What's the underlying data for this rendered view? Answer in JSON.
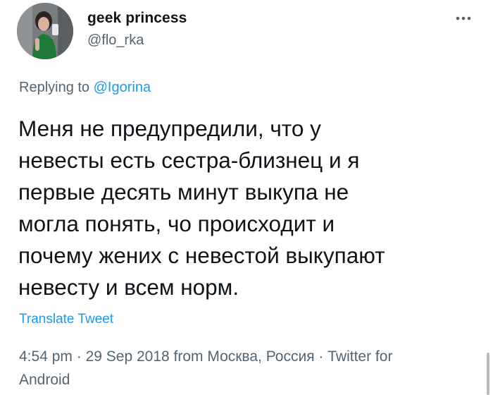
{
  "author": {
    "display_name": "geek princess",
    "handle": "@flo_rka"
  },
  "reply": {
    "prefix": "Replying to ",
    "mention": "@Igorina"
  },
  "tweet": {
    "lines": [
      "Меня не предупредили, что у",
      "невесты есть сестра-близнец и я",
      "первые десять минут выкупа не",
      "могла понять, чо происходит и",
      "почему жених с невестой выкупают",
      "невесту и всем норм."
    ]
  },
  "translate_label": "Translate Tweet",
  "meta": {
    "time": "4:54 pm",
    "sep1": " · ",
    "date": "29 Sep 2018",
    "location": " from Москва, Россия",
    "sep2": " · ",
    "source_line1": "Twitter for",
    "source_line2": "Android"
  },
  "icons": {
    "more": "more-horizontal-icon"
  },
  "colors": {
    "text": "#0f1419",
    "secondary": "#536471",
    "link": "#1d9bf0",
    "background": "#ffffff"
  }
}
